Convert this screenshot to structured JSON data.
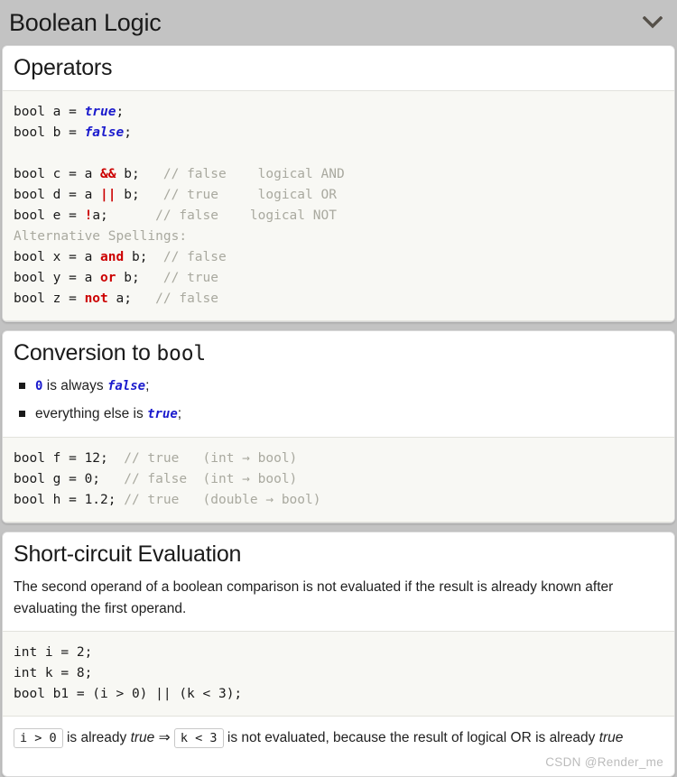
{
  "header": {
    "title": "Boolean Logic",
    "chevron_icon": "chevron-down-icon"
  },
  "sections": [
    {
      "id": "operators",
      "title": "Operators",
      "code_lines": [
        [
          {
            "t": "bool a = ",
            "c": "plain"
          },
          {
            "t": "true",
            "c": "kw"
          },
          {
            "t": ";",
            "c": "plain"
          }
        ],
        [
          {
            "t": "bool b = ",
            "c": "plain"
          },
          {
            "t": "false",
            "c": "kw"
          },
          {
            "t": ";",
            "c": "plain"
          }
        ],
        [
          {
            "t": "",
            "c": "plain"
          }
        ],
        [
          {
            "t": "bool c = a ",
            "c": "plain"
          },
          {
            "t": "&&",
            "c": "op"
          },
          {
            "t": " b;   ",
            "c": "plain"
          },
          {
            "t": "// false    logical AND",
            "c": "cmt"
          }
        ],
        [
          {
            "t": "bool d = a ",
            "c": "plain"
          },
          {
            "t": "||",
            "c": "op"
          },
          {
            "t": " b;   ",
            "c": "plain"
          },
          {
            "t": "// true     logical OR",
            "c": "cmt"
          }
        ],
        [
          {
            "t": "bool e = ",
            "c": "plain"
          },
          {
            "t": "!",
            "c": "op"
          },
          {
            "t": "a;      ",
            "c": "plain"
          },
          {
            "t": "// false    logical NOT",
            "c": "cmt"
          }
        ],
        [
          {
            "t": "Alternative Spellings:",
            "c": "cmt"
          }
        ],
        [
          {
            "t": "bool x = a ",
            "c": "plain"
          },
          {
            "t": "and",
            "c": "op"
          },
          {
            "t": " b;  ",
            "c": "plain"
          },
          {
            "t": "// false",
            "c": "cmt"
          }
        ],
        [
          {
            "t": "bool y = a ",
            "c": "plain"
          },
          {
            "t": "or",
            "c": "op"
          },
          {
            "t": " b;   ",
            "c": "plain"
          },
          {
            "t": "// true",
            "c": "cmt"
          }
        ],
        [
          {
            "t": "bool z = ",
            "c": "plain"
          },
          {
            "t": "not",
            "c": "op"
          },
          {
            "t": " a;   ",
            "c": "plain"
          },
          {
            "t": "// false",
            "c": "cmt"
          }
        ]
      ]
    },
    {
      "id": "conversion-to-bool",
      "title_prefix": "Conversion to ",
      "title_mono": "bool",
      "bullets": [
        [
          {
            "t": "0",
            "c": "kw-mono"
          },
          {
            "t": " is always ",
            "c": "body"
          },
          {
            "t": "false",
            "c": "kw"
          },
          {
            "t": ";",
            "c": "body"
          }
        ],
        [
          {
            "t": "everything else is ",
            "c": "body"
          },
          {
            "t": "true",
            "c": "kw"
          },
          {
            "t": ";",
            "c": "body"
          }
        ]
      ],
      "code_lines": [
        [
          {
            "t": "bool f = 12;  ",
            "c": "plain"
          },
          {
            "t": "// true   (int → bool)",
            "c": "cmt"
          }
        ],
        [
          {
            "t": "bool g = 0;   ",
            "c": "plain"
          },
          {
            "t": "// false  (int → bool)",
            "c": "cmt"
          }
        ],
        [
          {
            "t": "bool h = 1.2; ",
            "c": "plain"
          },
          {
            "t": "// true   (double → bool)",
            "c": "cmt"
          }
        ]
      ]
    },
    {
      "id": "short-circuit-evaluation",
      "title": "Short-circuit Evaluation",
      "paragraph": "The second operand of a boolean comparison is not evaluated if the result is already known after evaluating the first operand.",
      "code_lines": [
        [
          {
            "t": "int i = 2;",
            "c": "plain"
          }
        ],
        [
          {
            "t": "int k = 8;",
            "c": "plain"
          }
        ],
        [
          {
            "t": "bool b1 = (i > 0) || (k < 3);",
            "c": "plain"
          }
        ]
      ],
      "note": {
        "code_1": "i > 0",
        "mid_1": " is already ",
        "italic_1": "true",
        "arrow": " ⇒ ",
        "code_2": "k < 3",
        "mid_2": " is not evaluated, because the result of logical OR is already ",
        "italic_2": "true"
      },
      "watermark": "CSDN @Render_me"
    }
  ],
  "colors": {
    "page_background": "#c3c3c3",
    "card_background": "#ffffff",
    "code_background": "#f8f8f4",
    "keyword_blue": "#1b1bcd",
    "operator_red": "#cc0000",
    "comment_gray": "#a9a99f",
    "text_dark": "#1f1f1f",
    "watermark_gray": "#bcbcbc"
  }
}
